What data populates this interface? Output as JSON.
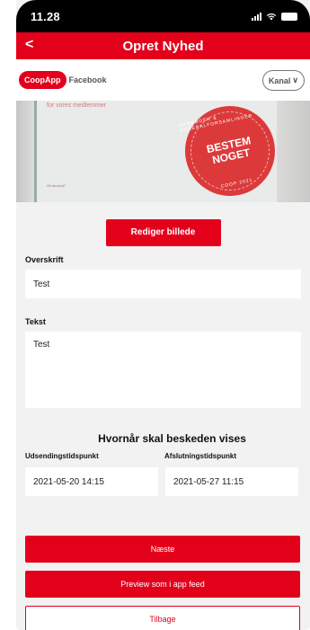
{
  "statusbar": {
    "time": "11.28"
  },
  "navbar": {
    "back_label": "<",
    "title": "Opret Nyhed"
  },
  "channels": {
    "active": "CoopApp",
    "inactive": "Facebook",
    "dropdown_label": "Kanal",
    "dropdown_arrow": "∨"
  },
  "image": {
    "headline": "for vores medlemmer",
    "small_text": "Vil du med?",
    "seal_top": "ÅRSMØDER & GENERALFORSAMLINGER",
    "seal_main_1": "BESTEM",
    "seal_main_2": "NOGET",
    "seal_bottom": "COOP 2021"
  },
  "edit_image_label": "Rediger billede",
  "form": {
    "headline_label": "Overskrift",
    "headline_value": "Test",
    "text_label": "Tekst",
    "text_value": "Test"
  },
  "schedule": {
    "title": "Hvornår skal beskeden vises",
    "send_label": "Udsendingstidspunkt",
    "end_label": "Afslutningstidspunkt",
    "send_value": "2021-05-20 14:15",
    "end_value": "2021-05-27 11:15"
  },
  "actions": {
    "next": "Næste",
    "preview": "Preview som i app feed",
    "back": "Tilbage"
  },
  "colors": {
    "brand_red": "#e3001b",
    "background": "#f2f2f2"
  }
}
